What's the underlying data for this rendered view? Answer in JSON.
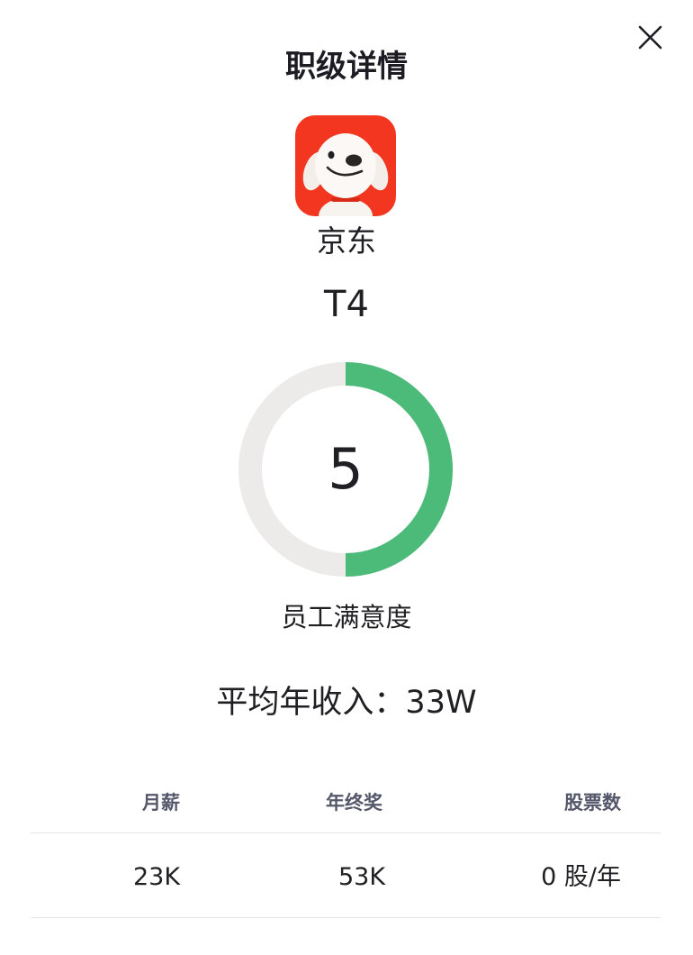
{
  "header": {
    "title": "职级详情",
    "close_icon": "close-icon"
  },
  "company": {
    "logo_icon": "jd-dog-logo-icon",
    "logo_color": "#f2361f",
    "name": "京东",
    "level": "T4"
  },
  "satisfaction": {
    "score": "5",
    "fill_fraction": 0.5,
    "fill_color": "#4cba79",
    "track_color": "#ecebea",
    "label": "员工满意度"
  },
  "income": {
    "text": "平均年收入：33W"
  },
  "compensation_table": {
    "headers": [
      "月薪",
      "年终奖",
      "股票数"
    ],
    "rows": [
      [
        "23K",
        "53K",
        "0 股/年"
      ]
    ]
  }
}
